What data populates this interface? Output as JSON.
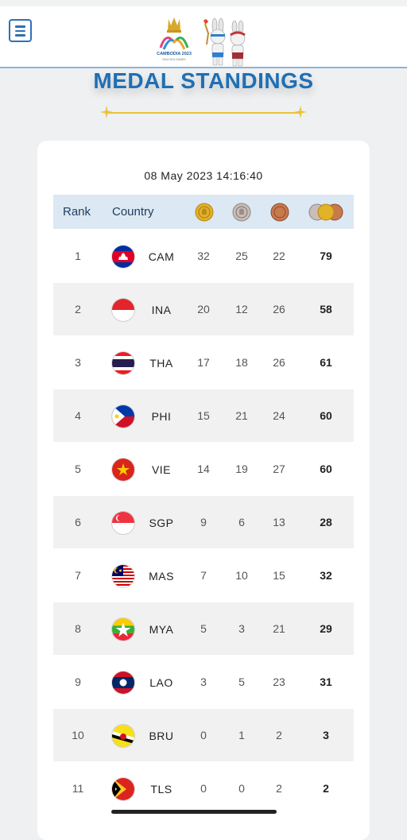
{
  "header": {
    "logo_text": "CAMBODIA 2023",
    "logo_subtext": "32nd SEA GAMES",
    "menu_icon": "hamburger-menu-icon"
  },
  "page": {
    "title": "MEDAL STANDINGS",
    "datetime": "08 May 2023  14:16:40"
  },
  "table": {
    "headers": {
      "rank": "Rank",
      "country": "Country",
      "gold": "gold-medal-icon",
      "silver": "silver-medal-icon",
      "bronze": "bronze-medal-icon",
      "total": "total-medals-icon"
    },
    "rows": [
      {
        "rank": "1",
        "code": "CAM",
        "gold": "32",
        "silver": "25",
        "bronze": "22",
        "total": "79"
      },
      {
        "rank": "2",
        "code": "INA",
        "gold": "20",
        "silver": "12",
        "bronze": "26",
        "total": "58"
      },
      {
        "rank": "3",
        "code": "THA",
        "gold": "17",
        "silver": "18",
        "bronze": "26",
        "total": "61"
      },
      {
        "rank": "4",
        "code": "PHI",
        "gold": "15",
        "silver": "21",
        "bronze": "24",
        "total": "60"
      },
      {
        "rank": "5",
        "code": "VIE",
        "gold": "14",
        "silver": "19",
        "bronze": "27",
        "total": "60"
      },
      {
        "rank": "6",
        "code": "SGP",
        "gold": "9",
        "silver": "6",
        "bronze": "13",
        "total": "28"
      },
      {
        "rank": "7",
        "code": "MAS",
        "gold": "7",
        "silver": "10",
        "bronze": "15",
        "total": "32"
      },
      {
        "rank": "8",
        "code": "MYA",
        "gold": "5",
        "silver": "3",
        "bronze": "21",
        "total": "29"
      },
      {
        "rank": "9",
        "code": "LAO",
        "gold": "3",
        "silver": "5",
        "bronze": "23",
        "total": "31"
      },
      {
        "rank": "10",
        "code": "BRU",
        "gold": "0",
        "silver": "1",
        "bronze": "2",
        "total": "3"
      },
      {
        "rank": "11",
        "code": "TLS",
        "gold": "0",
        "silver": "0",
        "bronze": "2",
        "total": "2"
      }
    ]
  },
  "colors": {
    "accent_blue": "#1f6fb4",
    "header_bg": "#dce8f3",
    "gold_line": "#e9c33a"
  }
}
